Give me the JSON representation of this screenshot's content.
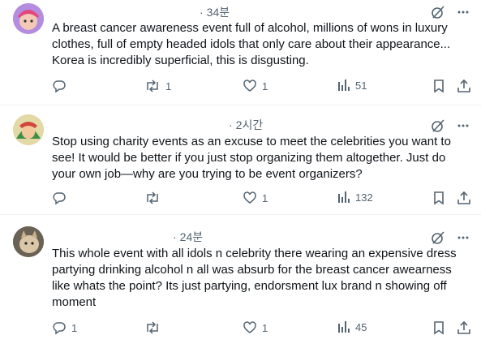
{
  "posts": [
    {
      "time": "34분",
      "text": "A breast cancer awareness event full of alcohol, millions of wons in luxury clothes, full of empty headed idols that only care about their appearance... Korea is incredibly superficial, this is disgusting.",
      "reply_count": "",
      "repost_count": "1",
      "like_count": "1",
      "view_count": "51"
    },
    {
      "time": "2시간",
      "text": "Stop using charity events as an excuse to meet the celebrities you want to see! It would be better if you just stop organizing them altogether. Just do your own job—why are you trying to be event organizers?",
      "reply_count": "",
      "repost_count": "",
      "like_count": "1",
      "view_count": "132"
    },
    {
      "time": "24분",
      "text": "This whole event with all idols n celebrity there wearing an expensive dress partying drinking alcohol n all was absurb for the breast cancer awearness like whats the point? Its just partying, endorsment lux brand n showing off moment",
      "reply_count": "1",
      "repost_count": "",
      "like_count": "1",
      "view_count": "45"
    }
  ],
  "separator": "·",
  "icons": [
    "grok-icon",
    "more-icon",
    "reply-icon",
    "repost-icon",
    "like-icon",
    "views-icon",
    "bookmark-icon",
    "share-icon"
  ],
  "colors": {
    "text": "#0f1419",
    "muted": "#536471",
    "border": "#eff3f4"
  }
}
